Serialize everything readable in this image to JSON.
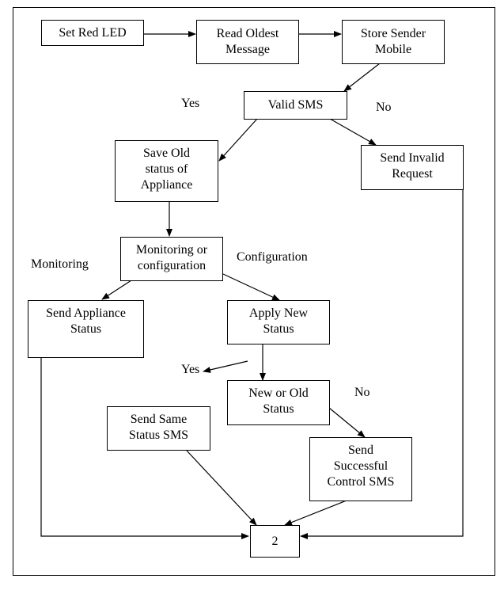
{
  "diagram": {
    "type": "flowchart",
    "nodes": {
      "set_red_led": "Set Red LED",
      "read_oldest_message": "Read Oldest\nMessage",
      "store_sender_mobile": "Store Sender\nMobile",
      "valid_sms": "Valid SMS",
      "save_old_status": "Save Old\nstatus of\nAppliance",
      "send_invalid_request": "Send Invalid\nRequest",
      "monitoring_or_configuration": "Monitoring or\nconfiguration",
      "send_appliance_status": "Send Appliance\nStatus",
      "apply_new_status": "Apply New\nStatus",
      "new_or_old_status": "New or Old\nStatus",
      "send_same_status_sms": "Send Same\nStatus SMS",
      "send_successful_control_sms": "Send\nSuccessful\nControl SMS",
      "connector_2": "2"
    },
    "labels": {
      "valid_yes": "Yes",
      "valid_no": "No",
      "monitoring": "Monitoring",
      "configuration": "Configuration",
      "status_yes": "Yes",
      "status_no": "No"
    },
    "edges": [
      {
        "from": "set_red_led",
        "to": "read_oldest_message"
      },
      {
        "from": "read_oldest_message",
        "to": "store_sender_mobile"
      },
      {
        "from": "store_sender_mobile",
        "to": "valid_sms"
      },
      {
        "from": "valid_sms",
        "to": "save_old_status",
        "label": "Yes"
      },
      {
        "from": "valid_sms",
        "to": "send_invalid_request",
        "label": "No"
      },
      {
        "from": "save_old_status",
        "to": "monitoring_or_configuration"
      },
      {
        "from": "monitoring_or_configuration",
        "to": "send_appliance_status",
        "label": "Monitoring"
      },
      {
        "from": "monitoring_or_configuration",
        "to": "apply_new_status",
        "label": "Configuration"
      },
      {
        "from": "apply_new_status",
        "to": "new_or_old_status"
      },
      {
        "from": "new_or_old_status",
        "to": "send_successful_control_sms",
        "label": "No"
      },
      {
        "from": "send_same_status_sms",
        "to": "connector_2"
      },
      {
        "from": "send_successful_control_sms",
        "to": "connector_2"
      },
      {
        "from": "send_appliance_status",
        "to": "connector_2"
      },
      {
        "from": "send_invalid_request",
        "to": "connector_2"
      }
    ]
  }
}
